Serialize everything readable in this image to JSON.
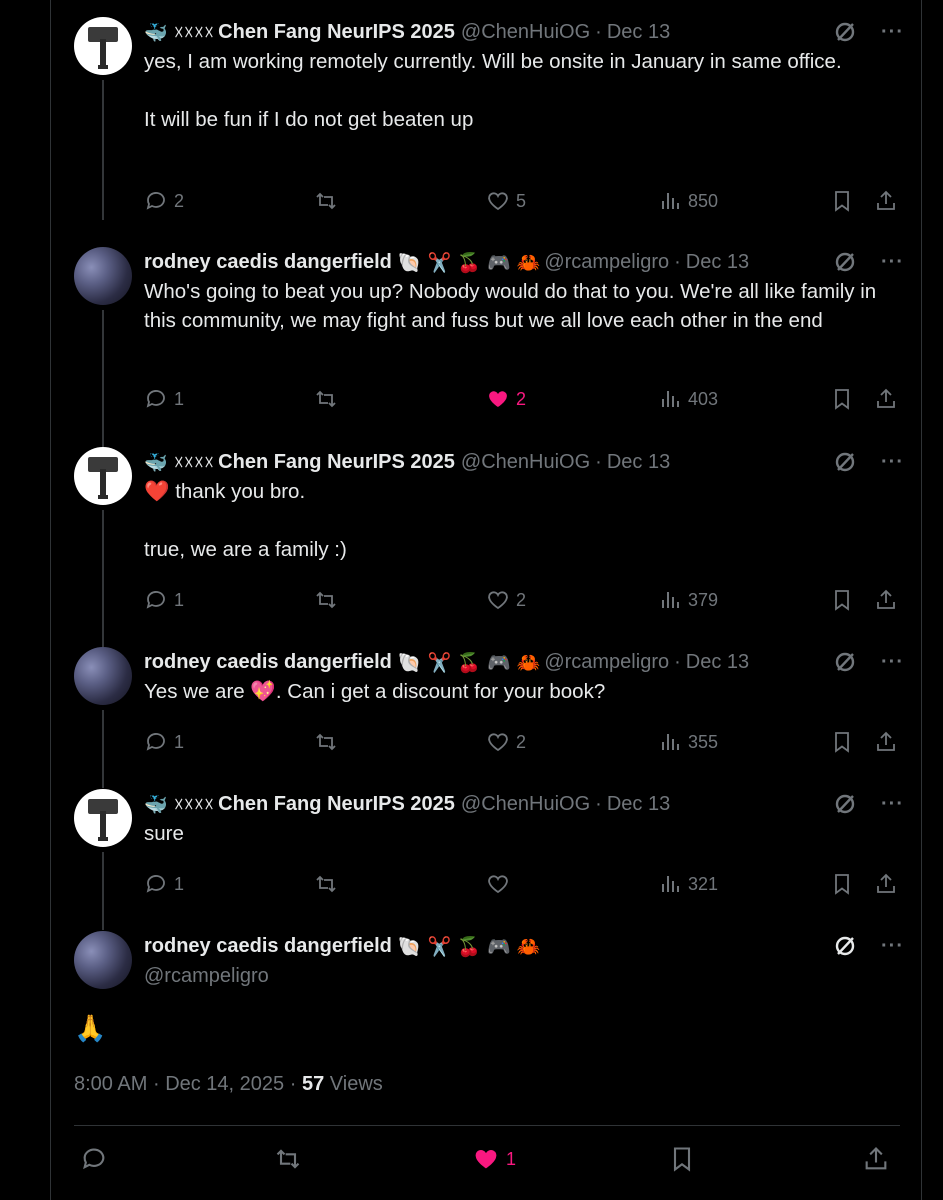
{
  "tweets": [
    {
      "author": "chen",
      "badges": "🐳 ☓☓☓☓",
      "name": "Chen Fang",
      "apple": "",
      "suffix": "NeurIPS 2025",
      "handle": "@ChenHuiOG",
      "date": "Dec 13",
      "text": "yes, I am working remotely currently. Will be onsite in January in same office.\n\nIt will be fun if I do not get beaten up",
      "replies": "2",
      "likes": "5",
      "views": "850",
      "liked": false
    },
    {
      "author": "rodney",
      "name": "rodney caedis dangerfield",
      "badges": "🐚 ✂️ 🍒 🎮 🦀",
      "handle": "@rcampeligro",
      "date": "Dec 13",
      "text": "Who's going to beat you up? Nobody would do that to you. We're all like family in this community, we may fight and fuss but we all love each other in the end",
      "replies": "1",
      "likes": "2",
      "views": "403",
      "liked": true
    },
    {
      "author": "chen",
      "badges": "🐳 ☓☓☓☓",
      "name": "Chen Fang",
      "apple": "",
      "suffix": "NeurIPS 2025",
      "handle": "@ChenHuiOG",
      "date": "Dec 13",
      "text": "❤️ thank you bro.\n\ntrue, we are a family :)",
      "replies": "1",
      "likes": "2",
      "views": "379",
      "liked": false
    },
    {
      "author": "rodney",
      "name": "rodney caedis dangerfield",
      "badges": "🐚 ✂️ 🍒 🎮 🦀",
      "handle": "@rcampeligro",
      "date": "Dec 13",
      "text": "Yes we are 💖. Can i get a discount for your book?",
      "replies": "1",
      "likes": "2",
      "views": "355",
      "liked": false
    },
    {
      "author": "chen",
      "badges": "🐳 ☓☓☓☓",
      "name": "Chen Fang",
      "apple": "",
      "suffix": "NeurIPS 2025",
      "handle": "@ChenHuiOG",
      "date": "Dec 13",
      "text": "sure",
      "replies": "1",
      "likes": "",
      "views": "321",
      "liked": false
    }
  ],
  "focus": {
    "name": "rodney caedis dangerfield",
    "badges": "🐚 ✂️ 🍒 🎮 🦀",
    "handle": "@rcampeligro",
    "text": "🙏",
    "time": "8:00 AM",
    "date": "Dec 14, 2025",
    "views_count": "57",
    "views_label": "Views",
    "likes": "1"
  },
  "icons": [
    "reply-icon",
    "repost-icon",
    "like-icon",
    "bookmark-icon",
    "share-icon",
    "views-icon",
    "grok-icon",
    "more-icon"
  ],
  "colors": {
    "background": "#000000",
    "text": "#e7e9ea",
    "muted": "#71767b",
    "like": "#f91880",
    "border": "#2f3336"
  }
}
